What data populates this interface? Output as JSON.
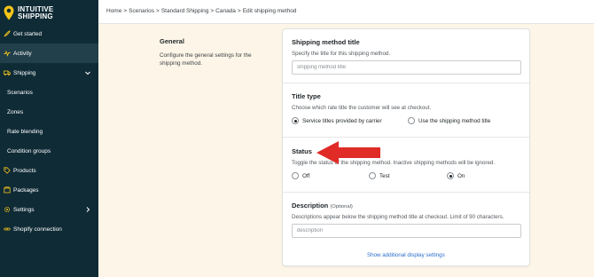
{
  "brand": {
    "line1": "INTUITIVE",
    "line2": "SHIPPING"
  },
  "nav": [
    {
      "label": "Get started",
      "icon": "rocket-icon"
    },
    {
      "label": "Activity",
      "icon": "activity-icon",
      "active": true
    },
    {
      "label": "Shipping",
      "icon": "truck-icon",
      "expanded": true
    },
    {
      "label": "Scenarios"
    },
    {
      "label": "Zones"
    },
    {
      "label": "Rate blending"
    },
    {
      "label": "Condition groups"
    },
    {
      "label": "Products",
      "icon": "tag-icon"
    },
    {
      "label": "Packages",
      "icon": "package-icon"
    },
    {
      "label": "Settings",
      "icon": "gear-icon"
    },
    {
      "label": "Shopify connection",
      "icon": "link-icon"
    }
  ],
  "breadcrumb": [
    "Home",
    "Scenarios",
    "Standard Shipping",
    "Canada",
    "Edit shipping method"
  ],
  "general": {
    "title": "General",
    "description": "Configure the general settings for the shipping method."
  },
  "shipping_method_title": {
    "title": "Shipping method title",
    "description": "Specify the title for this shipping method.",
    "placeholder": "shipping method title"
  },
  "title_type": {
    "title": "Title type",
    "description": "Choose which rate title the customer will see at checkout.",
    "options": [
      "Service titles provided by carrier",
      "Use the shipping method title"
    ],
    "selected": "Service titles provided by carrier"
  },
  "status": {
    "title": "Status",
    "description": "Toggle the status of the shipping method. Inactive shipping methods will be ignored.",
    "options": [
      "Off",
      "Test",
      "On"
    ],
    "selected": "On"
  },
  "description_section": {
    "title": "Description",
    "optional": "(Optional)",
    "description": "Descriptions appear below the shipping method title at checkout. Limit of 90 characters.",
    "placeholder": "description",
    "link": "Show additional display settings"
  },
  "colors": {
    "sidebar": "#0f2b36",
    "background": "#fdf6e8",
    "accent": "#f5c518",
    "arrow": "#e02b27",
    "link": "#2c6ecb"
  }
}
